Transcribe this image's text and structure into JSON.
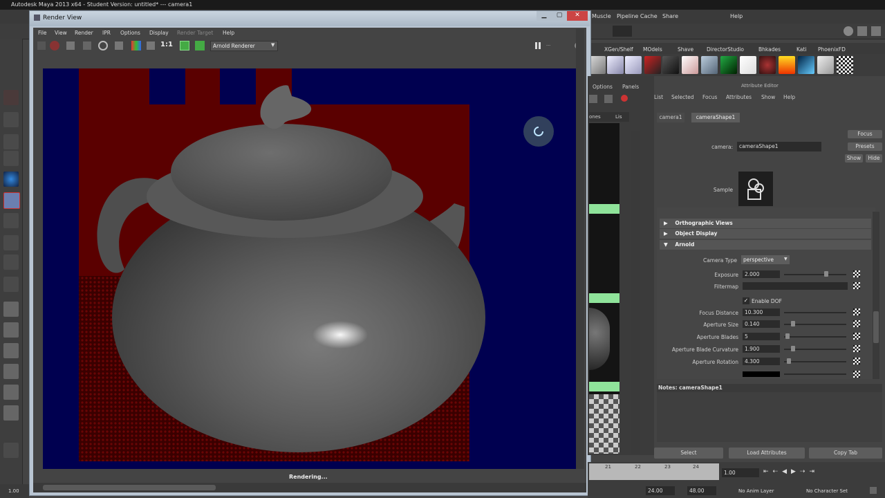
{
  "maya": {
    "title": "Autodesk Maya 2013 x64 - Student Version: untitled* --- camera1",
    "menus": [
      "Muscle",
      "Pipeline Cache",
      "Share",
      "Help"
    ],
    "shelf_tabs": [
      "XGen/Shelf",
      "MOdels",
      "Shave",
      "DirectorStudio",
      "Bhkades",
      "Kati",
      "PhoenixFD"
    ],
    "timeline": {
      "ticks": [
        "21",
        "22",
        "23",
        "24"
      ],
      "current": "1.00",
      "range_start": "1.00",
      "range_end": "24.00",
      "total": "48.00",
      "anim_layer": "No Anim Layer",
      "char_set": "No Character Set"
    }
  },
  "render_view": {
    "title": "Render View",
    "menus": [
      "File",
      "View",
      "Render",
      "IPR",
      "Options",
      "Display",
      "Render Target",
      "Help"
    ],
    "zoom_label": "1:1",
    "renderer": "Arnold Renderer",
    "status": "Rendering..."
  },
  "attribute_editor": {
    "title": "Attribute Editor",
    "menus": [
      "List",
      "Selected",
      "Focus",
      "Attributes",
      "Show",
      "Help"
    ],
    "tabs": [
      "camera1",
      "cameraShape1"
    ],
    "camera_label": "camera:",
    "camera_value": "cameraShape1",
    "buttons_right": [
      "Focus",
      "Presets",
      "Show",
      "Hide"
    ],
    "sample_label": "Sample",
    "sections": [
      "Orthographic Views",
      "Object Display",
      "Arnold"
    ],
    "camera_type_label": "Camera Type",
    "camera_type_value": "perspective",
    "exposure_label": "Exposure",
    "exposure_value": "2.000",
    "filtermap_label": "Filtermap",
    "enable_dof_label": "Enable DOF",
    "fields": [
      {
        "label": "Focus Distance",
        "value": "10.300"
      },
      {
        "label": "Aperture Size",
        "value": "0.140"
      },
      {
        "label": "Aperture Blades",
        "value": "5"
      },
      {
        "label": "Aperture Blade Curvature",
        "value": "1.900"
      },
      {
        "label": "Aperture Rotation",
        "value": "4.300"
      }
    ],
    "notes_label": "Notes: cameraShape1",
    "bottom_buttons": [
      "Select",
      "Load Attributes",
      "Copy Tab"
    ],
    "panel_menus": [
      "Options",
      "Panels"
    ]
  },
  "outliner": {
    "headers": [
      "ones",
      "Lis"
    ]
  }
}
